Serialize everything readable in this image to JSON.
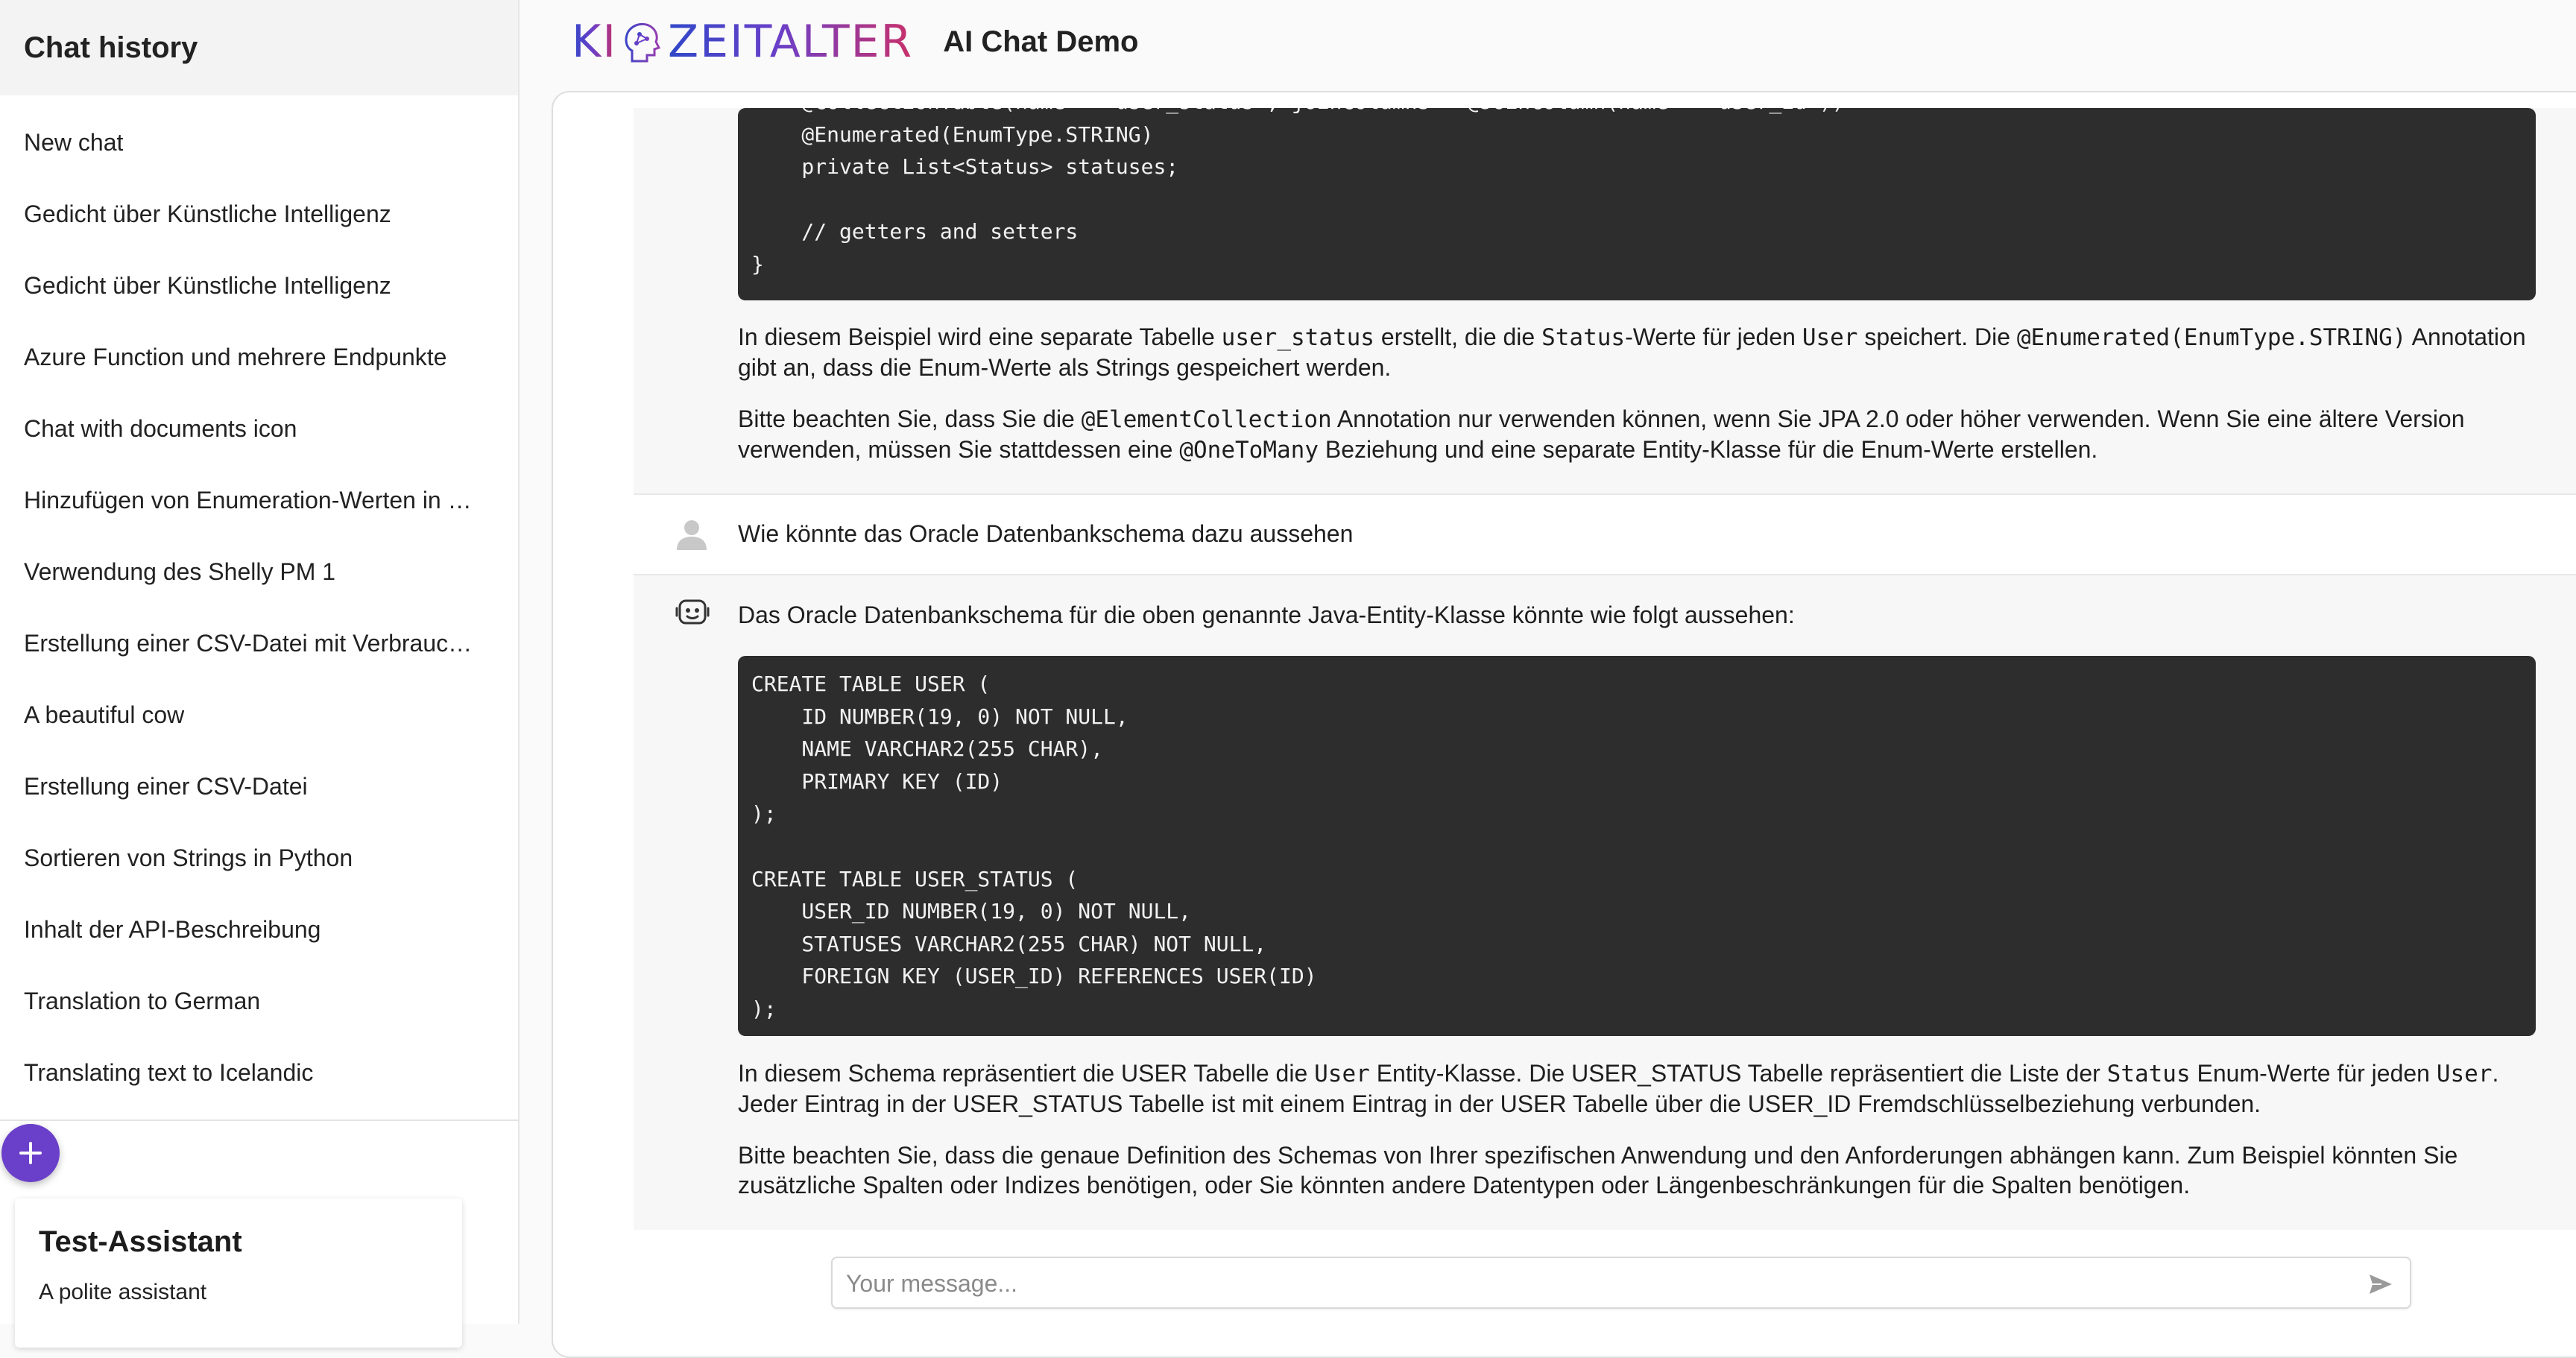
{
  "sidebar": {
    "title": "Chat history",
    "items": [
      {
        "label": "New chat"
      },
      {
        "label": "Gedicht über Künstliche Intelligenz"
      },
      {
        "label": "Gedicht über Künstliche Intelligenz"
      },
      {
        "label": "Azure Function und mehrere Endpunkte"
      },
      {
        "label": "Chat with documents icon"
      },
      {
        "label": "Hinzufügen von Enumeration-Werten in …"
      },
      {
        "label": "Verwendung des Shelly PM 1"
      },
      {
        "label": "Erstellung einer CSV-Datei mit Verbrauc…"
      },
      {
        "label": "A beautiful cow"
      },
      {
        "label": "Erstellung einer CSV-Datei"
      },
      {
        "label": "Sortieren von Strings in Python"
      },
      {
        "label": "Inhalt der API-Beschreibung"
      },
      {
        "label": "Translation to German"
      },
      {
        "label": "Translating text to Icelandic"
      }
    ],
    "add_button_symbol": "+",
    "assistant": {
      "name": "Test-Assistant",
      "description": "A polite assistant"
    }
  },
  "header": {
    "logo_left": "KI",
    "logo_right": "ZEITALTER",
    "app_title": "AI Chat Demo"
  },
  "conversation": {
    "code_top": "    @CollectionTable(name = \"user_status\", joinColumns = @JoinColumn(name = \"user_id\"))\n    @Enumerated(EnumType.STRING)\n    private List<Status> statuses;\n\n    // getters and setters\n}",
    "p1": {
      "a": "In diesem Beispiel wird eine separate Tabelle ",
      "code1": "user_status",
      "b": " erstellt, die die ",
      "code2": "Status",
      "c": "-Werte für jeden ",
      "code3": "User",
      "d": " speichert. Die ",
      "code4": "@Enumerated(EnumType.STRING)",
      "e": " Annotation gibt an, dass die Enum-Werte als Strings gespeichert werden."
    },
    "p2": {
      "a": "Bitte beachten Sie, dass Sie die ",
      "code1": "@ElementCollection",
      "b": " Annotation nur verwenden können, wenn Sie JPA 2.0 oder höher verwenden. Wenn Sie eine ältere Version verwenden, müssen Sie stattdessen eine ",
      "code2": "@OneToMany",
      "c": " Beziehung und eine separate Entity-Klasse für die Enum-Werte erstellen."
    },
    "user_message": "Wie könnte das Oracle Datenbankschema dazu aussehen",
    "bot_intro": "Das Oracle Datenbankschema für die oben genannte Java-Entity-Klasse könnte wie folgt aussehen:",
    "code_sql": "CREATE TABLE USER (\n    ID NUMBER(19, 0) NOT NULL,\n    NAME VARCHAR2(255 CHAR),\n    PRIMARY KEY (ID)\n);\n\nCREATE TABLE USER_STATUS (\n    USER_ID NUMBER(19, 0) NOT NULL,\n    STATUSES VARCHAR2(255 CHAR) NOT NULL,\n    FOREIGN KEY (USER_ID) REFERENCES USER(ID)\n);",
    "p3": {
      "a": "In diesem Schema repräsentiert die USER Tabelle die ",
      "code1": "User",
      "b": " Entity-Klasse. Die USER_STATUS Tabelle repräsentiert die Liste der ",
      "code2": "Status",
      "c": " Enum-Werte für jeden ",
      "code3": "User",
      "d": ". Jeder Eintrag in der USER_STATUS Tabelle ist mit einem Eintrag in der USER Tabelle über die USER_ID Fremdschlüsselbeziehung verbunden."
    },
    "p4": "Bitte beachten Sie, dass die genaue Definition des Schemas von Ihrer spezifischen Anwendung und den Anforderungen abhängen kann. Zum Beispiel könnten Sie zusätzliche Spalten oder Indizes benötigen, oder Sie könnten andere Datentypen oder Längenbeschränkungen für die Spalten benötigen."
  },
  "composer": {
    "placeholder": "Your message..."
  },
  "colors": {
    "accent": "#6a3fc9",
    "code_bg": "#2d2d2d"
  },
  "icons": {
    "user": "user-avatar-icon",
    "bot": "bot-avatar-icon",
    "send": "send-icon",
    "add": "plus-icon"
  }
}
